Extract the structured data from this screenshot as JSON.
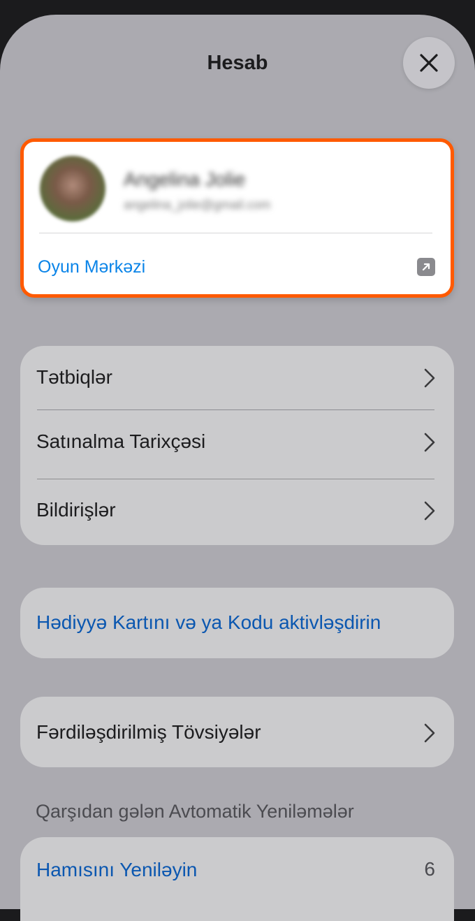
{
  "header": {
    "title": "Hesab",
    "close_icon": "close-icon"
  },
  "account": {
    "name": "Angelina Jolie",
    "email": "angelina_jolie@gmail.com",
    "game_center_label": "Oyun Mərkəzi",
    "external_icon": "external-link-icon",
    "highlight_color": "#ff5a00",
    "link_color": "#0a84e8"
  },
  "menu": {
    "items": [
      {
        "label": "Tətbiqlər"
      },
      {
        "label": "Satınalma Tarixçəsi"
      },
      {
        "label": "Bildirişlər"
      }
    ]
  },
  "redeem": {
    "label": "Hədiyyə Kartını və ya Kodu aktivləşdirin"
  },
  "recommendations": {
    "label": "Fərdiləşdirilmiş Tövsiyələr"
  },
  "updates": {
    "section_title": "Qarşıdan gələn Avtomatik Yeniləmələr",
    "update_all_label": "Hamısını Yeniləyin",
    "count": "6"
  }
}
